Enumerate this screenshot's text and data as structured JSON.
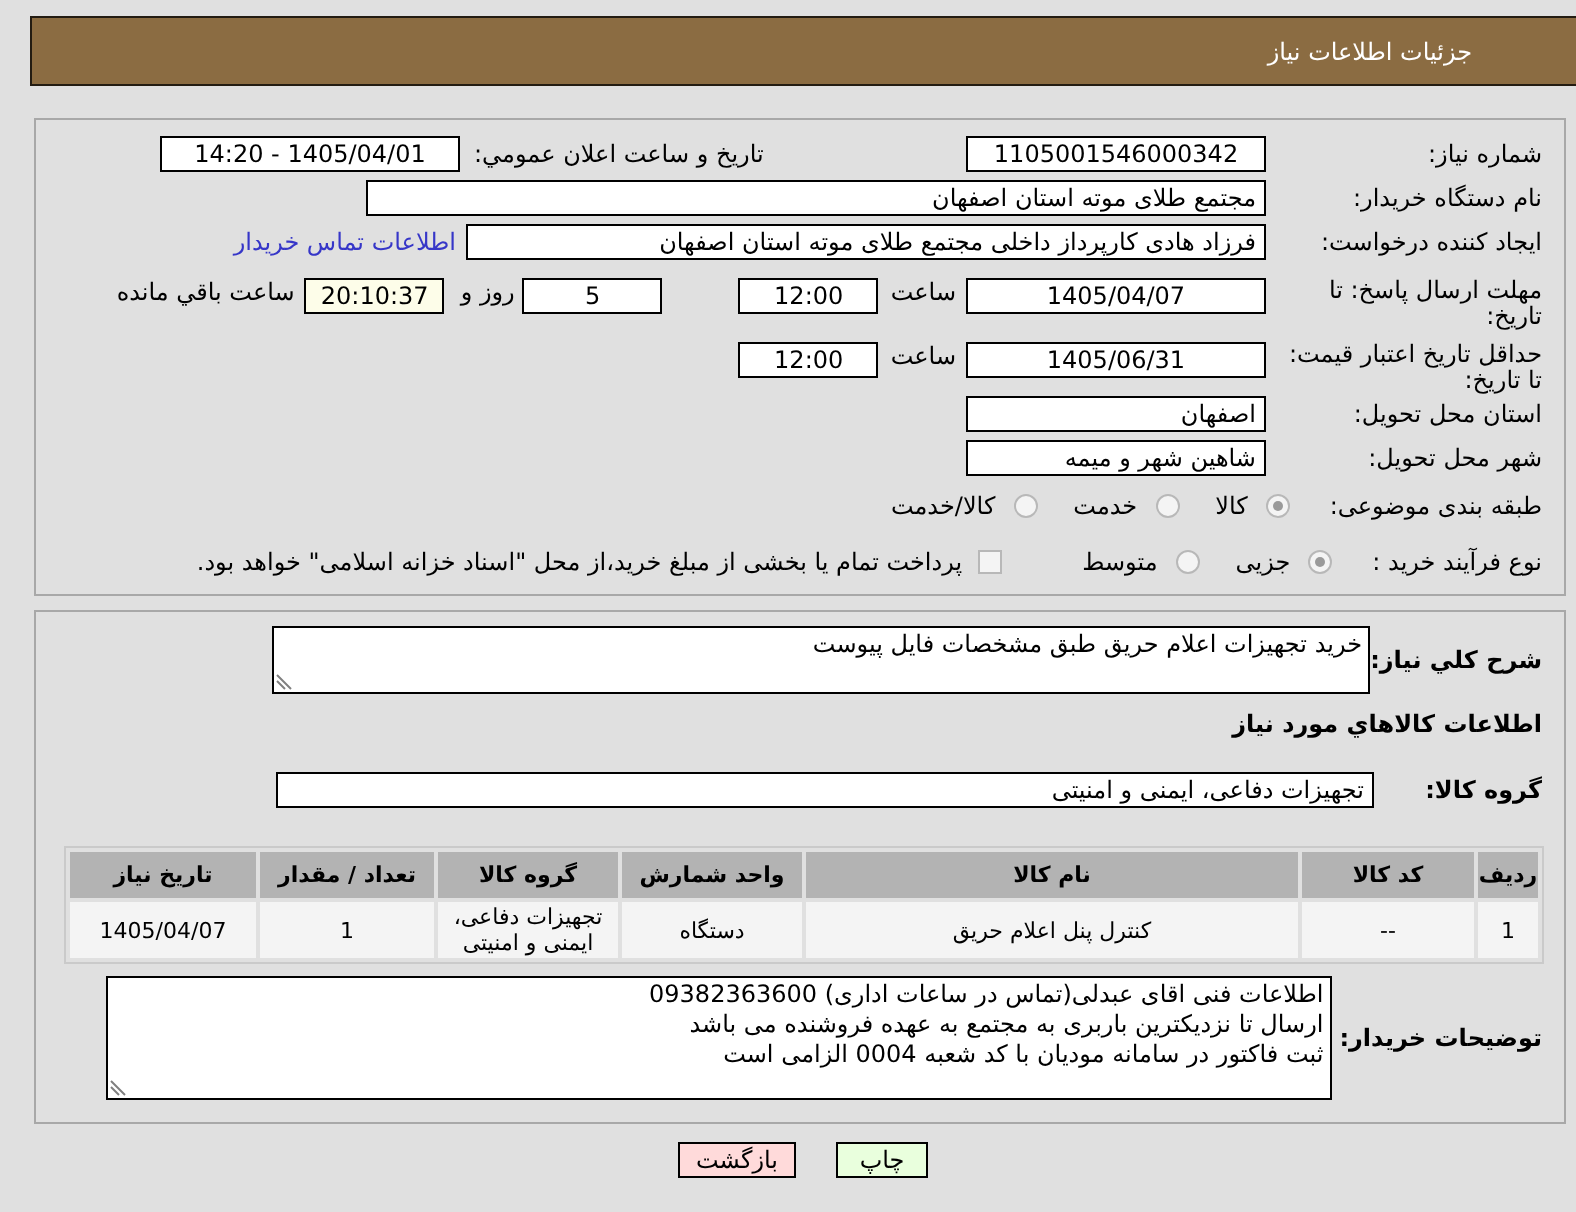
{
  "header": {
    "title": "جزئیات اطلاعات نیاز"
  },
  "need_number": {
    "label": "شماره نیاز:",
    "value": "1105001546000342"
  },
  "announcement": {
    "label": "تاریخ و ساعت اعلان عمومي:",
    "value": "1405/04/01 - 14:20"
  },
  "buyer_org": {
    "label": "نام دستگاه خریدار:",
    "value": "مجتمع طلای موته استان اصفهان"
  },
  "requester": {
    "label": "ایجاد کننده درخواست:",
    "value": "فرزاد هادی کارپرداز داخلی مجتمع طلای موته استان اصفهان",
    "contact_link": "اطلاعات تماس خریدار"
  },
  "response_deadline": {
    "label": "مهلت ارسال پاسخ: تا تاریخ:",
    "date": "1405/04/07",
    "time_label": "ساعت",
    "time": "12:00",
    "days": "5",
    "days_label": "روز و",
    "remaining": "20:10:37",
    "remaining_label": "ساعت باقي مانده"
  },
  "price_validity": {
    "label": "حداقل تاریخ اعتبار قیمت: تا تاریخ:",
    "date": "1405/06/31",
    "time_label": "ساعت",
    "time": "12:00"
  },
  "delivery_province": {
    "label": "استان محل تحویل:",
    "value": "اصفهان"
  },
  "delivery_city": {
    "label": "شهر محل تحویل:",
    "value": "شاهین شهر و میمه"
  },
  "category": {
    "label": "طبقه بندی موضوعی:",
    "options": [
      {
        "label": "کالا",
        "selected": true
      },
      {
        "label": "خدمت",
        "selected": false
      },
      {
        "label": "کالا/خدمت",
        "selected": false
      }
    ]
  },
  "process_type": {
    "label": "نوع فرآیند خرید :",
    "options": [
      {
        "label": "جزیی",
        "selected": true
      },
      {
        "label": "متوسط",
        "selected": false
      }
    ],
    "treasury_payment": {
      "label": "پرداخت تمام یا بخشی از مبلغ خرید،از محل \"اسناد خزانه اسلامی\" خواهد بود.",
      "checked": false
    }
  },
  "summary": {
    "label": "شرح كلي نياز:",
    "value": "خرید تجهیزات اعلام حریق طبق مشخصات فایل پیوست"
  },
  "goods_heading": "اطلاعات كالاهاي مورد نياز",
  "goods_group": {
    "label": "گروه کالا:",
    "value": "تجهیزات دفاعی، ایمنی و امنیتی"
  },
  "table": {
    "columns": [
      "ردیف",
      "کد کالا",
      "نام کالا",
      "واحد شمارش",
      "گروه کالا",
      "تعداد / مقدار",
      "تاریخ نیاز"
    ],
    "rows": [
      [
        "1",
        "--",
        "کنترل پنل اعلام حریق",
        "دستگاه",
        "تجهیزات دفاعی، ایمنی و امنیتی",
        "1",
        "1405/04/07"
      ]
    ]
  },
  "buyer_notes": {
    "label": "توضیحات خریدار:",
    "lines": [
      "اطلاعات فنی اقای عبدلی(تماس در ساعات اداری) 09382363600",
      "ارسال تا نزدیکترین باربری به مجتمع به عهده فروشنده می باشد",
      "ثبت فاکتور در سامانه مودیان با کد شعبه 0004 الزامی است"
    ]
  },
  "buttons": [
    {
      "label": "چاپ",
      "kind": "print"
    },
    {
      "label": "بازگشت",
      "kind": "back"
    }
  ]
}
